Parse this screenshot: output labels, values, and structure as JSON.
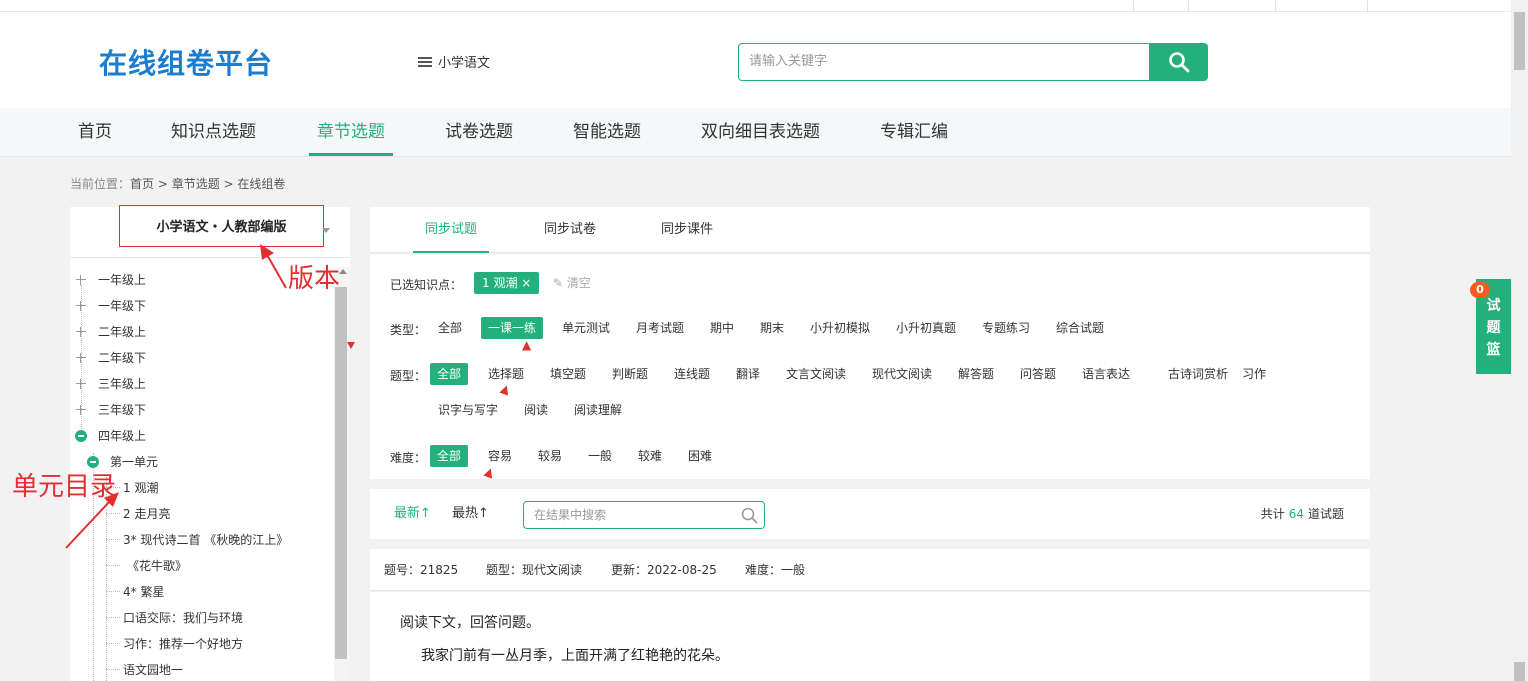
{
  "header": {
    "logo": "在线组卷平台",
    "subject": "小学语文",
    "search_placeholder": "请输入关键字"
  },
  "nav": [
    "首页",
    "知识点选题",
    "章节选题",
    "试卷选题",
    "智能选题",
    "双向细目表选题",
    "专辑汇编"
  ],
  "nav_active": "章节选题",
  "breadcrumb": {
    "label": "当前位置：",
    "home": "首页",
    "sep": " > ",
    "chapter": "章节选题",
    "current": "在线组卷"
  },
  "left": {
    "version": "小学语文・人教部编版",
    "tree": [
      "一年级上",
      "一年级下",
      "二年级上",
      "二年级下",
      "三年级上",
      "三年级下",
      "四年级上",
      "第一单元",
      "1 观潮",
      "2 走月亮",
      "3* 现代诗二首 《秋晚的江上》",
      "《花牛歌》",
      "4* 繁星",
      "口语交际：我们与环境",
      "习作：推荐一个好地方",
      "语文园地一"
    ]
  },
  "annotations": {
    "version": "版本",
    "unit": "单元目录"
  },
  "tabs": [
    "同步试题",
    "同步试卷",
    "同步课件"
  ],
  "filters": {
    "selected_label": "已选知识点：",
    "selected_tag": "1 观潮 ×",
    "clear": "清空",
    "type_label": "类型：",
    "types": [
      "全部",
      "一课一练",
      "单元测试",
      "月考试题",
      "期中",
      "期末",
      "小升初模拟",
      "小升初真题",
      "专题练习",
      "综合试题"
    ],
    "qtype_label": "题型：",
    "qtypes": [
      "全部",
      "选择题",
      "填空题",
      "判断题",
      "连线题",
      "翻译",
      "文言文阅读",
      "现代文阅读",
      "解答题",
      "问答题",
      "语言表达",
      "古诗词赏析",
      "习作",
      "识字与写字",
      "阅读",
      "阅读理解"
    ],
    "diff_label": "难度：",
    "diffs": [
      "全部",
      "容易",
      "较易",
      "一般",
      "较难",
      "困难"
    ]
  },
  "sort": {
    "newest": "最新↑",
    "hottest": "最热↑",
    "placeholder": "在结果中搜索",
    "total_prefix": "共计",
    "total": "64",
    "total_suffix": "道试题"
  },
  "question": {
    "id": "题号：21825",
    "type": "题型：现代文阅读",
    "updated": "更新：2022-08-25",
    "difficulty": "难度：一般",
    "line1": "阅读下文，回答问题。",
    "line2": "我家门前有一丛月季，上面开满了红艳艳的花朵。"
  },
  "basket": {
    "count": "0",
    "label": [
      "试",
      "题",
      "篮"
    ]
  },
  "colors": {
    "accent": "#23b07d",
    "logo": "#1a7dd0",
    "annotation": "#e03030",
    "badge": "#ff5a1f"
  }
}
